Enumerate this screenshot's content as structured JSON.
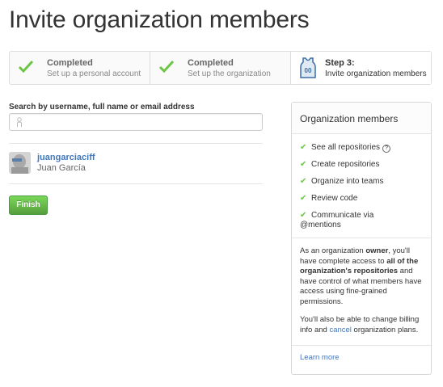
{
  "page": {
    "title": "Invite organization members"
  },
  "steps": [
    {
      "status": "Completed",
      "label": "Set up a personal account",
      "icon": "check-icon"
    },
    {
      "status": "Completed",
      "label": "Set up the organization",
      "icon": "check-icon"
    },
    {
      "status": "Step 3:",
      "label": "Invite organization members",
      "icon": "jersey-icon"
    }
  ],
  "search": {
    "label": "Search by username, full name or email address",
    "value": "",
    "placeholder": ""
  },
  "member": {
    "login": "juangarciaciff",
    "name": "Juan García"
  },
  "actions": {
    "finish_label": "Finish"
  },
  "panel": {
    "title": "Organization members",
    "permissions": [
      "See all repositories",
      "Create repositories",
      "Organize into teams",
      "Review code",
      "Communicate via",
      "@mentions"
    ],
    "desc1_a": "As an organization ",
    "desc1_owner": "owner",
    "desc1_b": ", you'll have complete access to ",
    "desc1_all": "all of the organization's repositories",
    "desc1_c": " and have control of what members have access using fine-grained permissions.",
    "desc2_a": "You'll also be able to change billing info and ",
    "desc2_cancel": "cancel",
    "desc2_b": " organization plans.",
    "learn_more": "Learn more"
  },
  "colors": {
    "accent_green": "#6cc644",
    "link_blue": "#4078c0",
    "button_green": "#60b044"
  }
}
